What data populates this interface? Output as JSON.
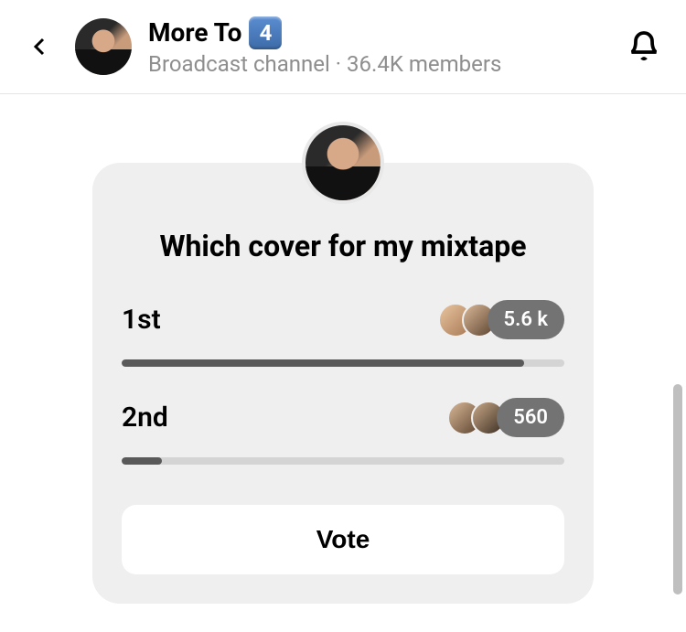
{
  "header": {
    "title": "More To",
    "emoji_label": "4",
    "subtitle_type": "Broadcast channel",
    "subtitle_sep": " · ",
    "members": "36.4K members"
  },
  "poll": {
    "question": "Which cover for my mixtape",
    "options": [
      {
        "label": "1st",
        "count": "5.6 k",
        "percent": 91
      },
      {
        "label": "2nd",
        "count": "560",
        "percent": 9
      }
    ],
    "vote_label": "Vote"
  }
}
